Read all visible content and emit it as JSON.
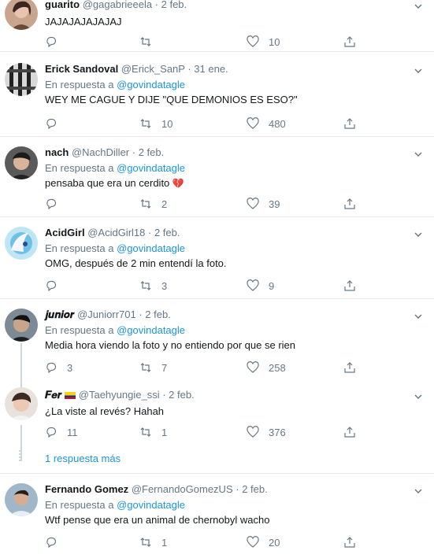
{
  "tweets": [
    {
      "name": "guarito",
      "handle": "@gagabrieeela",
      "date": "2 feb.",
      "reply_prefix": "",
      "reply_to": "",
      "text": "JAJAJAJAJAJAJ",
      "replies": "",
      "retweets": "",
      "likes": "10"
    },
    {
      "name": "Erick Sandoval",
      "handle": "@Erick_SanP",
      "date": "31 ene.",
      "reply_prefix": "En respuesta a",
      "reply_to": "@govindatagle",
      "text": "WEY ME CAGUE Y DIJE \"QUE DEMONIOS ES ESO?\"",
      "replies": "",
      "retweets": "10",
      "likes": "480"
    },
    {
      "name": "nach",
      "handle": "@NachDiller",
      "date": "2 feb.",
      "reply_prefix": "En respuesta a",
      "reply_to": "@govindatagle",
      "text": "pensaba que era un cerdito",
      "emoji": "💔",
      "replies": "",
      "retweets": "2",
      "likes": "39"
    },
    {
      "name": "AcidGirl",
      "handle": "@AcidGirl18",
      "date": "2 feb.",
      "reply_prefix": "En respuesta a",
      "reply_to": "@govindatagle",
      "text": "OMG, después de 2 min entendí la foto.",
      "replies": "",
      "retweets": "3",
      "likes": "9"
    },
    {
      "name": "𝒋𝒖𝒏𝒊𝒐𝒓",
      "handle": "@Juniorr701",
      "date": "2 feb.",
      "reply_prefix": "En respuesta a",
      "reply_to": "@govindatagle",
      "text": "Media hora viendo la foto y no entiendo por que se rien",
      "replies": "3",
      "retweets": "7",
      "likes": "258"
    },
    {
      "name": "𝑭𝒆𝒓",
      "handle": "@Taehyungie_ssi",
      "date": "2 feb.",
      "reply_prefix": "",
      "reply_to": "",
      "text": "¿La viste al revés? Hahah",
      "replies": "11",
      "retweets": "1",
      "likes": "376"
    },
    {
      "name": "Fernando Gomez",
      "handle": "@FernandoGomezUS",
      "date": "2 feb.",
      "reply_prefix": "En respuesta a",
      "reply_to": "@govindatagle",
      "text": "Wtf pense que era un animal de chernobyl wacho",
      "replies": "",
      "retweets": "1",
      "likes": "20"
    }
  ],
  "more_replies": "1 respuesta más",
  "separator": " · "
}
